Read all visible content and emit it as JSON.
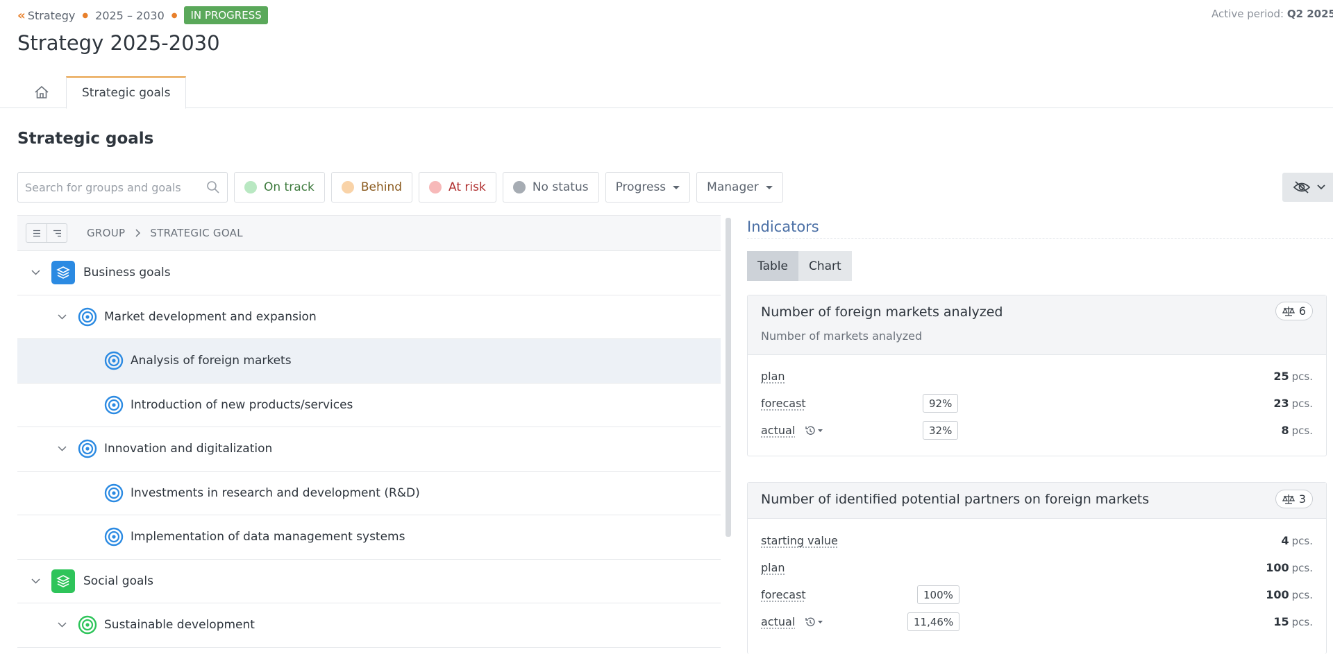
{
  "breadcrumb": {
    "back": "Strategy",
    "period": "2025 – 2030",
    "status": "IN PROGRESS"
  },
  "active_period": {
    "label": "Active period:",
    "value": "Q2 2025"
  },
  "page_title": "Strategy 2025-2030",
  "tabs": [
    {
      "label": "Strategic goals"
    }
  ],
  "section_title": "Strategic goals",
  "filters": {
    "search_placeholder": "Search for groups and goals",
    "statuses": [
      {
        "label": "On track",
        "dot_color": "#b9e8c2",
        "text_color": "#3d7a3d"
      },
      {
        "label": "Behind",
        "dot_color": "#f9d3a8",
        "text_color": "#8a5a1e"
      },
      {
        "label": "At risk",
        "dot_color": "#f7b9b9",
        "text_color": "#b03030"
      },
      {
        "label": "No status",
        "dot_color": "#a6acb3",
        "text_color": "#5d6570"
      }
    ],
    "progress_label": "Progress",
    "manager_label": "Manager"
  },
  "tree": {
    "header": {
      "group": "GROUP",
      "goal": "STRATEGIC GOAL"
    },
    "rows": [
      {
        "label": "Business goals",
        "type": "group",
        "color": "#2b8ae2"
      },
      {
        "label": "Market development and expansion",
        "type": "goal",
        "color": "#2b8ae2"
      },
      {
        "label": "Analysis of foreign markets",
        "type": "subgoal",
        "color": "#2b8ae2"
      },
      {
        "label": "Introduction of new products/services",
        "type": "subgoal",
        "color": "#2b8ae2"
      },
      {
        "label": "Innovation and digitalization",
        "type": "goal",
        "color": "#2b8ae2"
      },
      {
        "label": "Investments in research and development (R&D)",
        "type": "subgoal",
        "color": "#2b8ae2"
      },
      {
        "label": "Implementation of data management systems",
        "type": "subgoal",
        "color": "#2b8ae2"
      },
      {
        "label": "Social goals",
        "type": "group",
        "color": "#2ec45a"
      },
      {
        "label": "Sustainable development",
        "type": "goal",
        "color": "#2ec45a"
      }
    ]
  },
  "indicators": {
    "title": "Indicators",
    "view_tabs": [
      "Table",
      "Chart"
    ],
    "cards": [
      {
        "title": "Number of foreign markets analyzed",
        "subtitle": "Number of markets analyzed",
        "weight": "6",
        "metrics": [
          {
            "label": "plan",
            "value": "25",
            "unit": "pcs.",
            "pct": ""
          },
          {
            "label": "forecast",
            "value": "23",
            "unit": "pcs.",
            "pct": "92%"
          },
          {
            "label": "actual",
            "value": "8",
            "unit": "pcs.",
            "pct": "32%"
          }
        ]
      },
      {
        "title": "Number of identified potential partners on foreign markets",
        "subtitle": "",
        "weight": "3",
        "metrics": [
          {
            "label": "starting value",
            "value": "4",
            "unit": "pcs.",
            "pct": ""
          },
          {
            "label": "plan",
            "value": "100",
            "unit": "pcs.",
            "pct": ""
          },
          {
            "label": "forecast",
            "value": "100",
            "unit": "pcs.",
            "pct": "100%"
          },
          {
            "label": "actual",
            "value": "15",
            "unit": "pcs.",
            "pct": "11,46%"
          }
        ]
      }
    ]
  }
}
